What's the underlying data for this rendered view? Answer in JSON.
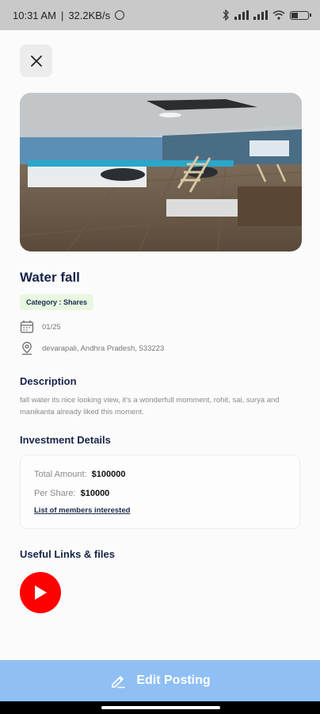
{
  "status_bar": {
    "time": "10:31 AM",
    "network_speed": "32.2KB/s",
    "battery_level": 0.4
  },
  "post": {
    "title": "Water fall",
    "category": "Category : Shares",
    "date": "01/25",
    "location": "devarapali, Andhra Pradesh, 533223"
  },
  "description": {
    "heading": "Description",
    "text": "fall water its nice looking view, it's a wonderfull momment, rohit, sai, surya and manikanta already liked this moment."
  },
  "investment": {
    "heading": "Investment Details",
    "total_label": "Total Amount:",
    "total_value": "$100000",
    "per_share_label": "Per Share:",
    "per_share_value": "$10000",
    "members_link": "List of members interested"
  },
  "links": {
    "heading": "Useful Links & files"
  },
  "footer": {
    "edit_label": "Edit Posting"
  },
  "colors": {
    "accent": "#8fbff4",
    "title": "#17244a",
    "badge_bg": "#e7f7e1",
    "youtube": "#ff0000"
  },
  "icons": {
    "close": "close-icon",
    "calendar": "calendar-icon",
    "location": "location-pin-icon",
    "youtube": "youtube-play-icon",
    "edit": "pencil-icon"
  }
}
